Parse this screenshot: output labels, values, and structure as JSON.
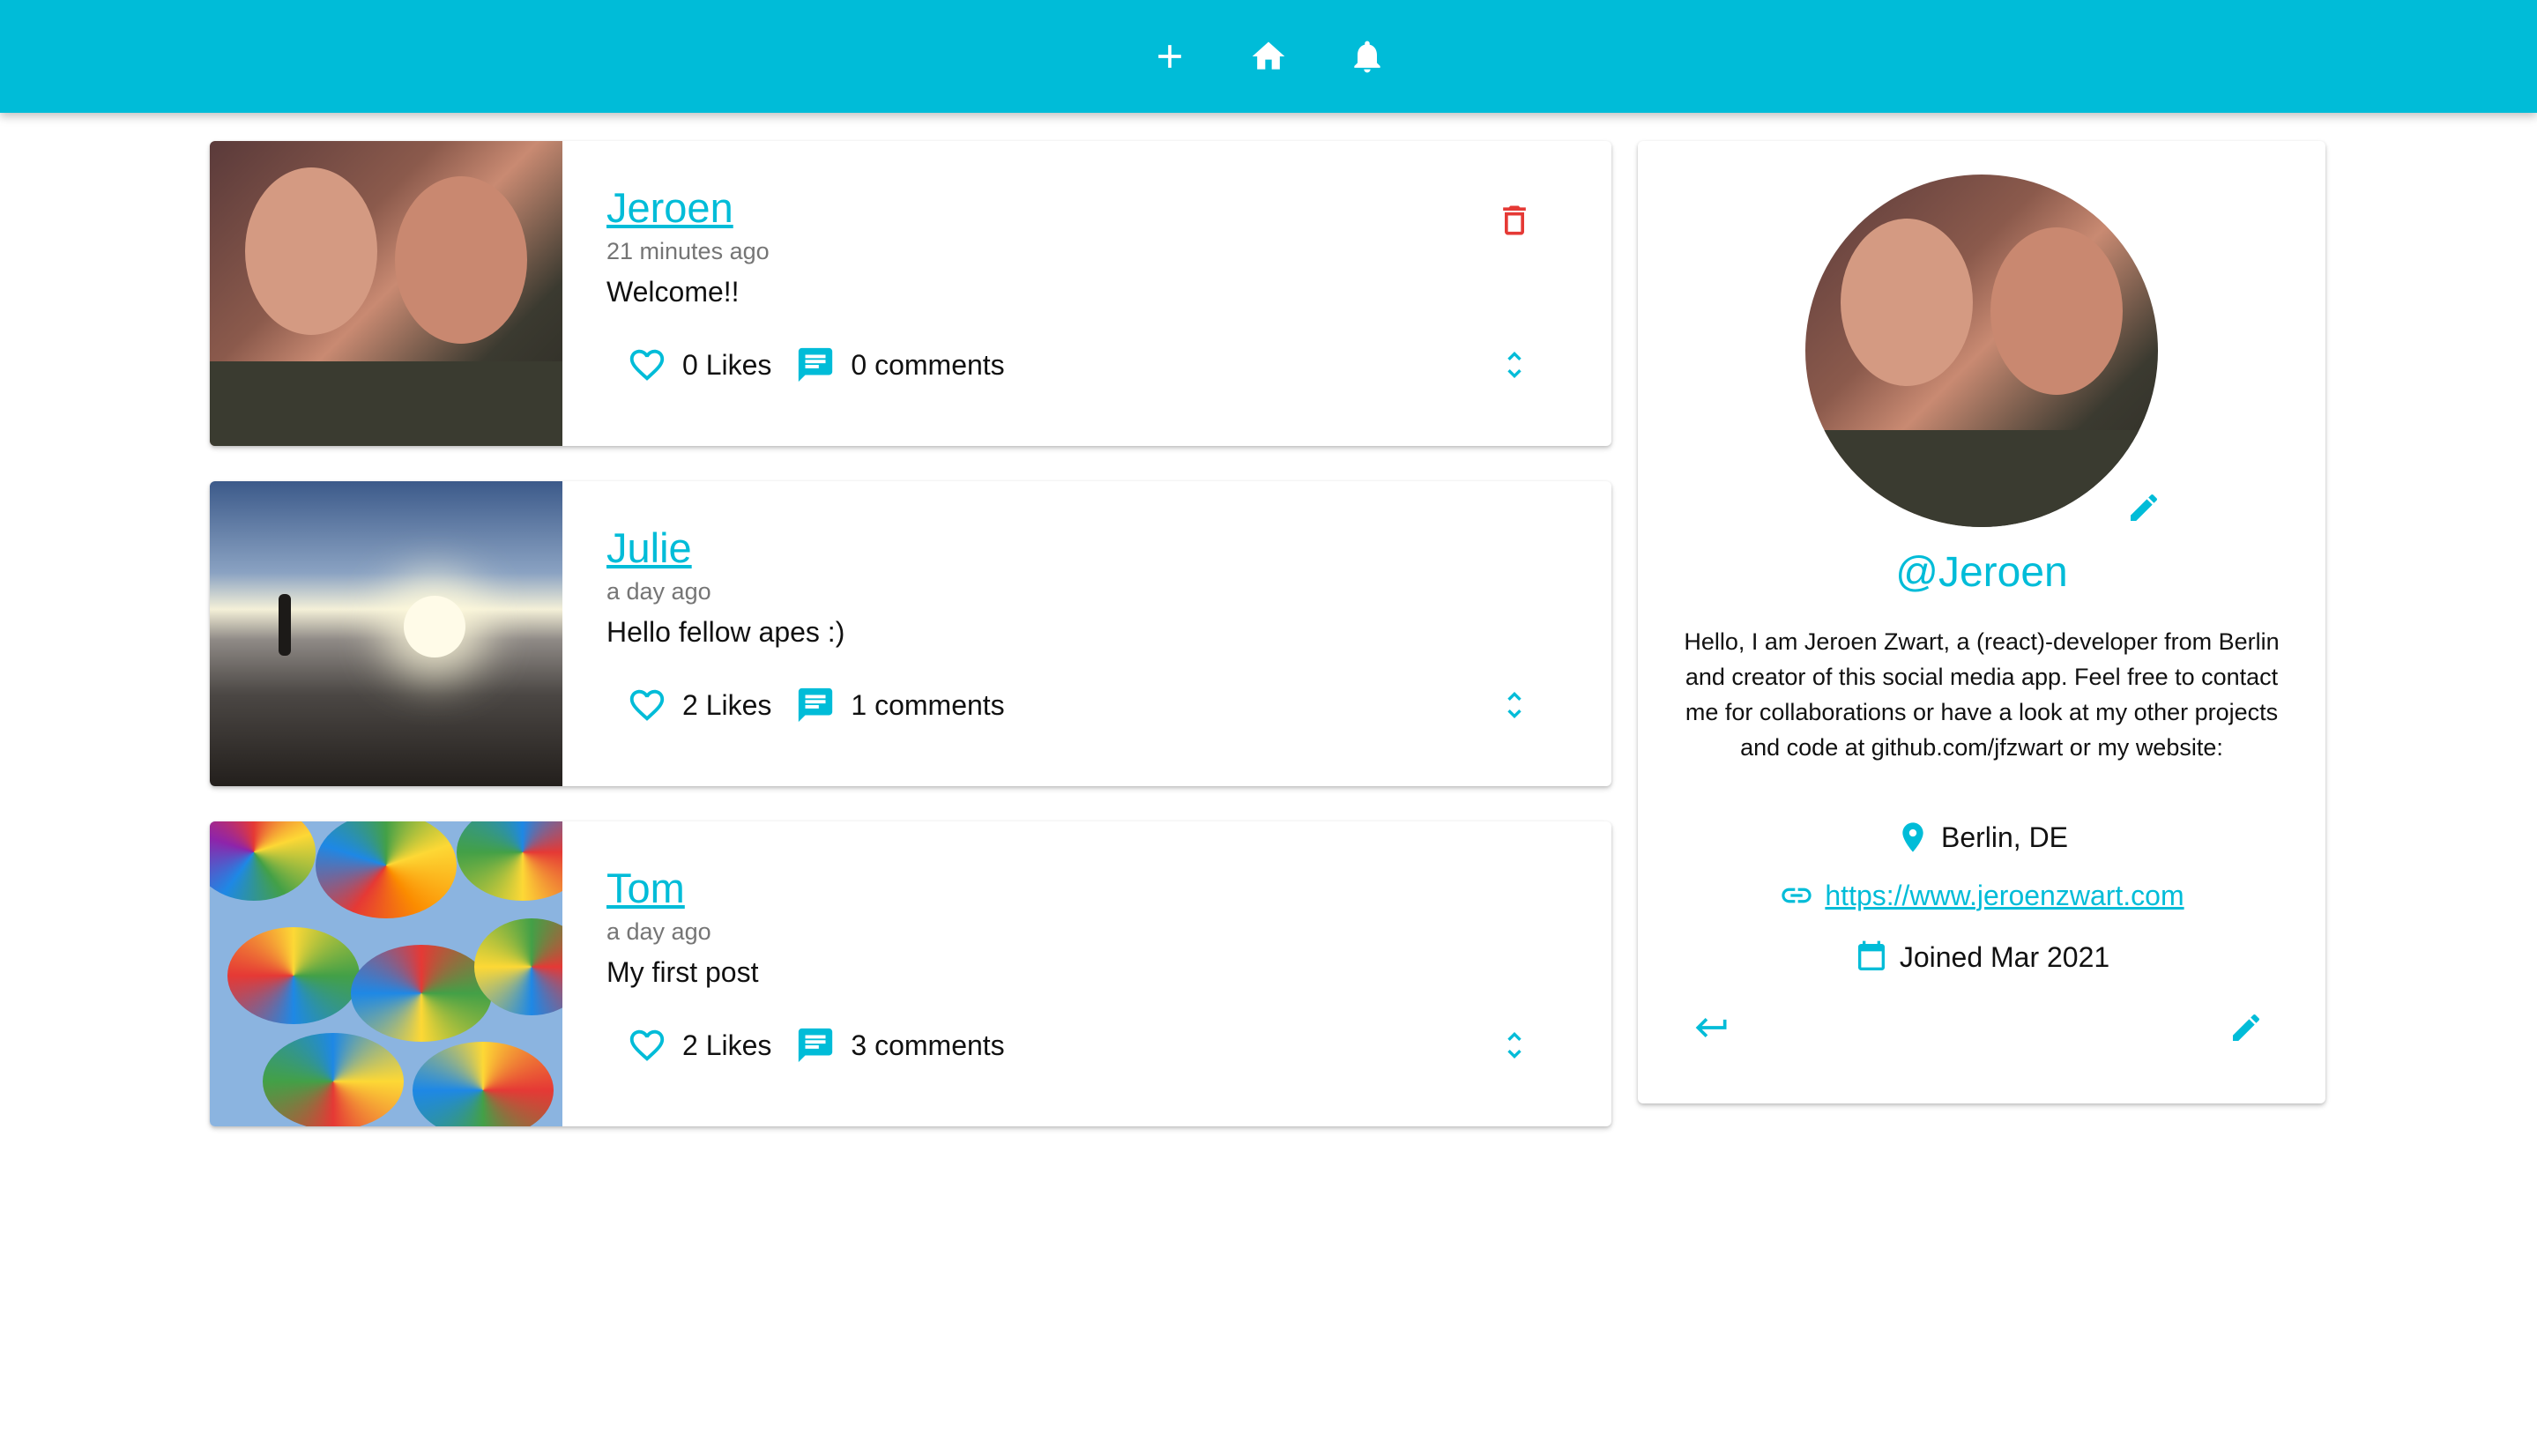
{
  "appbar": {
    "icons": [
      "add-icon",
      "home-icon",
      "bell-icon"
    ],
    "color": "#00bcd8"
  },
  "posts": [
    {
      "handle": "Jeroen",
      "time": "21 minutes ago",
      "text": "Welcome!!",
      "likes": "0 Likes",
      "comments": "0 comments",
      "deletable": true
    },
    {
      "handle": "Julie",
      "time": "a day ago",
      "text": "Hello fellow apes :)",
      "likes": "2 Likes",
      "comments": "1 comments",
      "deletable": false
    },
    {
      "handle": "Tom",
      "time": "a day ago",
      "text": "My first post",
      "likes": "2 Likes",
      "comments": "3 comments",
      "deletable": false
    }
  ],
  "profile": {
    "handle": "@Jeroen",
    "bio": "Hello, I am Jeroen Zwart, a (react)-developer from Berlin and creator of this social media app. Feel free to contact me for collaborations or have a look at my other projects and code at github.com/jfzwart or my website:",
    "location": "Berlin, DE",
    "website": " https://www.jeroenzwart.com",
    "joined": "Joined Mar 2021"
  },
  "colors": {
    "accent": "#00bcd8",
    "delete": "#e53935"
  }
}
